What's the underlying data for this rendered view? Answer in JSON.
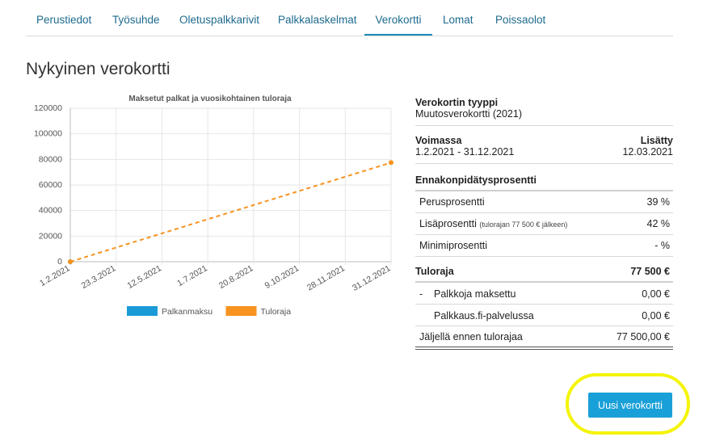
{
  "tabs": [
    {
      "label": "Perustiedot"
    },
    {
      "label": "Työsuhde"
    },
    {
      "label": "Oletuspalkkarivit"
    },
    {
      "label": "Palkkalaskelmat"
    },
    {
      "label": "Verokortti"
    },
    {
      "label": "Lomat"
    },
    {
      "label": "Poissaolot"
    }
  ],
  "active_tab": "Verokortti",
  "page_title": "Nykyinen verokortti",
  "chart_data": {
    "type": "line",
    "title": "Maksetut palkat ja vuosikohtainen tuloraja",
    "xlabel": "",
    "ylabel": "",
    "ylim": [
      0,
      120000
    ],
    "y_ticks": [
      "0",
      "20000",
      "40000",
      "60000",
      "80000",
      "100000",
      "120000"
    ],
    "x_ticks": [
      "1.2.2021",
      "23.3.2021",
      "12.5.2021",
      "1.7.2021",
      "20.8.2021",
      "9.10.2021",
      "28.11.2021",
      "31.12.2021"
    ],
    "grid": true,
    "legend_position": "bottom",
    "series": [
      {
        "name": "Palkanmaksu",
        "color": "#1a9bd7",
        "x": [
          "1.2.2021"
        ],
        "values": [
          0
        ]
      },
      {
        "name": "Tuloraja",
        "color": "#f7931e",
        "style": "dashed",
        "x": [
          "1.2.2021",
          "31.12.2021"
        ],
        "values": [
          0,
          77500
        ]
      }
    ]
  },
  "card": {
    "type_label": "Verokortin tyyppi",
    "type_value": "Muutosverokortti (2021)",
    "valid_label": "Voimassa",
    "valid_value": "1.2.2021 - 31.12.2021",
    "added_label": "Lisätty",
    "added_value": "12.03.2021",
    "withholding_label": "Ennakonpidätysprosentti",
    "base_label": "Perusprosentti",
    "base_value": "39 %",
    "extra_label": "Lisäprosentti",
    "extra_note": "(tulorajan 77 500 € jälkeen)",
    "extra_value": "42 %",
    "min_label": "Minimiprosentti",
    "min_value": "- %",
    "limit_label": "Tuloraja",
    "limit_value": "77 500 €",
    "paid_prefix": "-",
    "paid_label": "Palkkoja maksettu",
    "paid_value": "0,00 €",
    "service_label": "Palkkaus.fi-palvelussa",
    "service_value": "0,00 €",
    "remaining_label": "Jäljellä ennen tulorajaa",
    "remaining_value": "77 500,00 €"
  },
  "new_card_button": "Uusi verokortti"
}
